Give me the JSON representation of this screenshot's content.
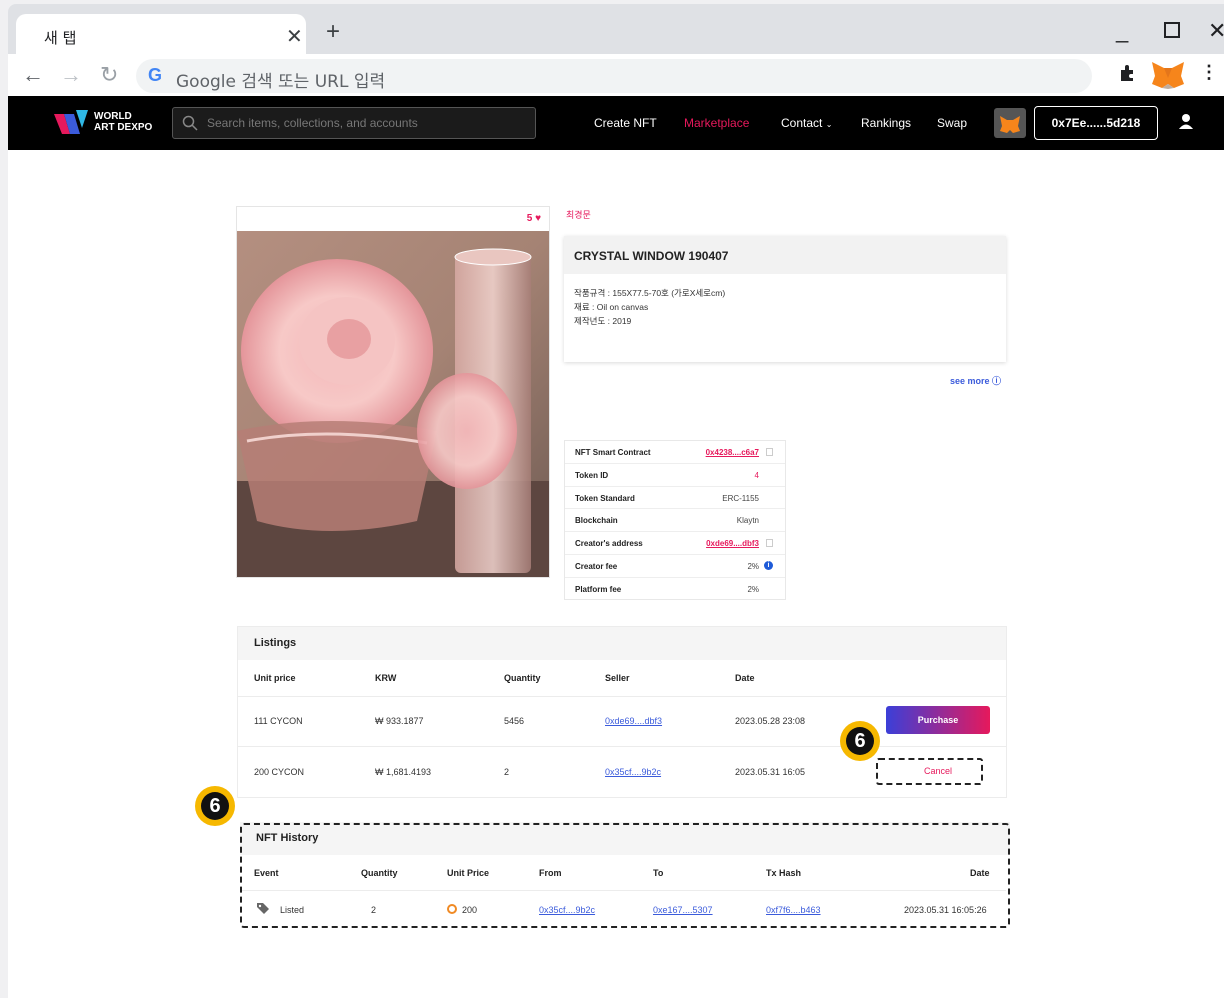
{
  "browser": {
    "tab_title": "새 탭",
    "omnibox_placeholder": "Google 검색 또는 URL 입력"
  },
  "site": {
    "logo_line1": "WORLD",
    "logo_line2": "ART DEXPO",
    "search_placeholder": "Search items, collections, and accounts",
    "nav": {
      "create": "Create NFT",
      "marketplace": "Marketplace",
      "contact": "Contact",
      "rankings": "Rankings",
      "swap": "Swap"
    },
    "wallet": "0x7Ee......5d218"
  },
  "artwork": {
    "likes": "5",
    "artist": "최경문",
    "title": "CRYSTAL WINDOW 190407",
    "desc_line1": "작품규격 : 155X77.5-70호 (가로X세로cm)",
    "desc_line2": "재료 : Oil on canvas",
    "desc_line3": "제작년도 : 2019",
    "see_more": "see more ⓘ"
  },
  "details": [
    {
      "k": "NFT Smart Contract",
      "v": "0x4238....c6a7"
    },
    {
      "k": "Token ID",
      "v": "4"
    },
    {
      "k": "Token Standard",
      "v": "ERC-1155"
    },
    {
      "k": "Blockchain",
      "v": "Klaytn"
    },
    {
      "k": "Creator's address",
      "v": "0xde69....dbf3"
    },
    {
      "k": "Creator fee",
      "v": "2%"
    },
    {
      "k": "Platform fee",
      "v": "2%"
    }
  ],
  "listings": {
    "title": "Listings",
    "headers": {
      "unit_price": "Unit price",
      "krw": "KRW",
      "quantity": "Quantity",
      "seller": "Seller",
      "date": "Date"
    },
    "rows": [
      {
        "unit_price": "111 CYCON",
        "krw": "₩ 933.1877",
        "quantity": "5456",
        "seller": "0xde69....dbf3",
        "date": "2023.05.28 23:08",
        "action": "Purchase"
      },
      {
        "unit_price": "200 CYCON",
        "krw": "₩ 1,681.4193",
        "quantity": "2",
        "seller": "0x35cf....9b2c",
        "date": "2023.05.31 16:05",
        "action": "Cancel"
      }
    ]
  },
  "history": {
    "title": "NFT History",
    "headers": {
      "event": "Event",
      "quantity": "Quantity",
      "unit_price": "Unit Price",
      "from": "From",
      "to": "To",
      "tx_hash": "Tx Hash",
      "date": "Date"
    },
    "rows": [
      {
        "event": "Listed",
        "quantity": "2",
        "unit_price": "200",
        "from": "0x35cf....9b2c",
        "to": "0xe167....5307",
        "tx_hash": "0xf7f6....b463",
        "date": "2023.05.31 16:05:26"
      }
    ]
  },
  "badge_number": "6",
  "colors": {
    "accent": "#e6195c",
    "link": "#3b5bdb",
    "badge": "#f6b800"
  }
}
